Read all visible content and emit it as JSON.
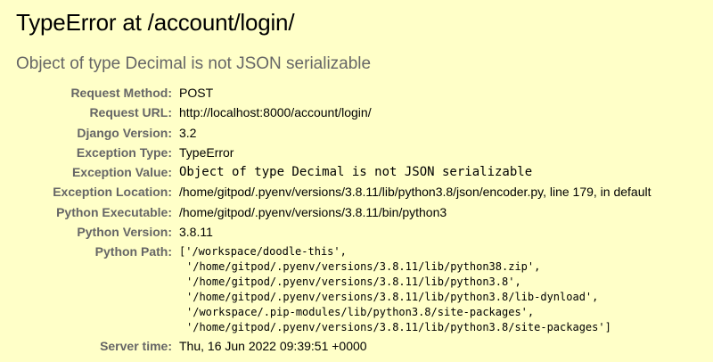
{
  "title": "TypeError at /account/login/",
  "subtitle": "Object of type Decimal is not JSON serializable",
  "meta": [
    {
      "key": "request_method",
      "label": "Request Method:",
      "value": "POST",
      "mono": false
    },
    {
      "key": "request_url",
      "label": "Request URL:",
      "value": "http://localhost:8000/account/login/",
      "mono": false
    },
    {
      "key": "django_version",
      "label": "Django Version:",
      "value": "3.2",
      "mono": false
    },
    {
      "key": "exception_type",
      "label": "Exception Type:",
      "value": "TypeError",
      "mono": false
    },
    {
      "key": "exception_value",
      "label": "Exception Value:",
      "value": "Object of type Decimal is not JSON serializable",
      "mono": true
    },
    {
      "key": "exception_location",
      "label": "Exception Location:",
      "value": "/home/gitpod/.pyenv/versions/3.8.11/lib/python3.8/json/encoder.py, line 179, in default",
      "mono": false
    },
    {
      "key": "python_executable",
      "label": "Python Executable:",
      "value": "/home/gitpod/.pyenv/versions/3.8.11/bin/python3",
      "mono": false
    },
    {
      "key": "python_version",
      "label": "Python Version:",
      "value": "3.8.11",
      "mono": false
    }
  ],
  "python_path": {
    "label": "Python Path:",
    "lines": [
      "['/workspace/doodle-this',",
      "'/home/gitpod/.pyenv/versions/3.8.11/lib/python38.zip',",
      "'/home/gitpod/.pyenv/versions/3.8.11/lib/python3.8',",
      "'/home/gitpod/.pyenv/versions/3.8.11/lib/python3.8/lib-dynload',",
      "'/workspace/.pip-modules/lib/python3.8/site-packages',",
      "'/home/gitpod/.pyenv/versions/3.8.11/lib/python3.8/site-packages']"
    ]
  },
  "server_time": {
    "label": "Server time:",
    "value": "Thu, 16 Jun 2022 09:39:51 +0000"
  },
  "colors": {
    "background": "#ffffc8",
    "label_gray": "#666666",
    "text": "#000000"
  }
}
